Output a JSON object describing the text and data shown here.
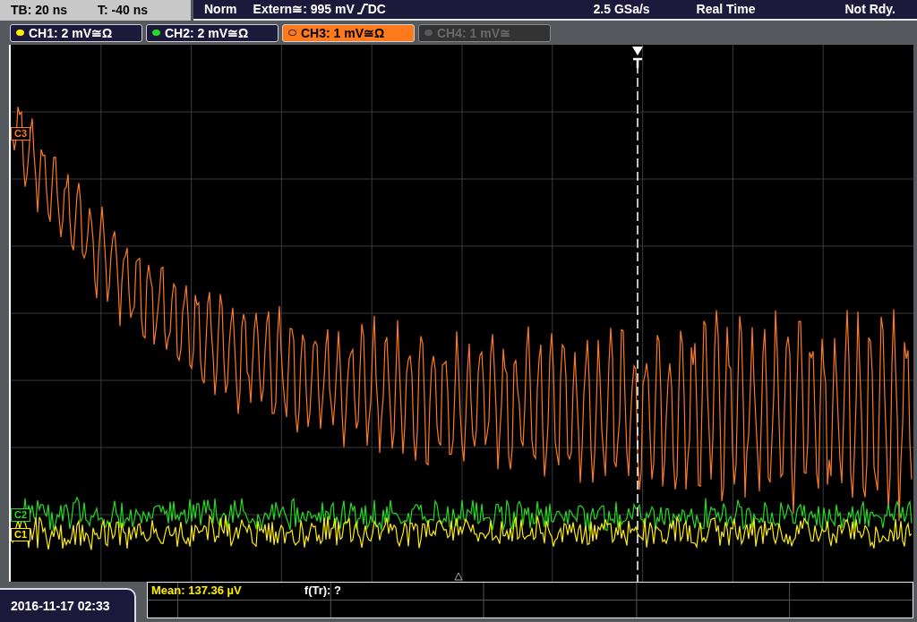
{
  "timebase": {
    "tb": "TB: 20 ns",
    "t": "T: -40 ns"
  },
  "acquisition": {
    "mode": "Norm",
    "source": "Extern≅: 995 mV",
    "coupling": "DC",
    "sample_rate": "2.5 GSa/s",
    "type": "Real Time",
    "status": "Not Rdy."
  },
  "channels": [
    {
      "label": "CH1: 2 mV≅Ω",
      "color": "#ffee00",
      "selected": false,
      "on": true
    },
    {
      "label": "CH2: 2 mV≅Ω",
      "color": "#22dd22",
      "selected": false,
      "on": true
    },
    {
      "label": "CH3: 1 mV≅Ω",
      "color": "#ff7a1c",
      "selected": true,
      "on": true
    },
    {
      "label": "CH4: 1 mV≅",
      "color": "#5a5a5a",
      "selected": false,
      "on": false
    }
  ],
  "traces": [
    {
      "kind": "decay",
      "color": "#ff7a1c",
      "marker": "C3"
    },
    {
      "kind": "noise",
      "color": "#22dd22",
      "marker": "C2"
    },
    {
      "kind": "noise",
      "color": "#ffee00",
      "marker": "C1"
    }
  ],
  "measurements": [
    {
      "text": "Mean: 137.36 µV",
      "color": "#ffee00"
    },
    {
      "text": "f(Tr): ?",
      "color": "#ffffff"
    }
  ],
  "date": "2016-11-17 02:33"
}
